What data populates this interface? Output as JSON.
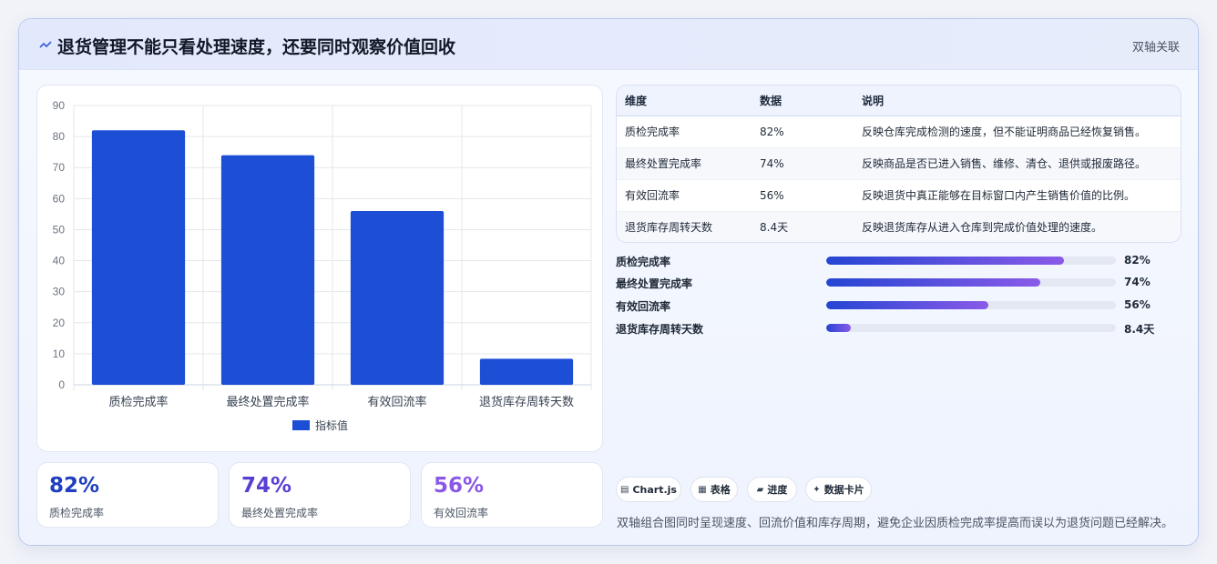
{
  "header": {
    "icon": "trend-line-icon",
    "title": "退货管理不能只看处理速度，还要同时观察价值回收",
    "tag": "双轴关联"
  },
  "chart_data": {
    "type": "bar",
    "categories": [
      "质检完成率",
      "最终处置完成率",
      "有效回流率",
      "退货库存周转天数"
    ],
    "series": [
      {
        "name": "指标值",
        "values": [
          82,
          74,
          56,
          8.4
        ],
        "color": "#1c4fd6"
      }
    ],
    "ylim": [
      0,
      90
    ],
    "yticks": [
      0,
      10,
      20,
      30,
      40,
      50,
      60,
      70,
      80,
      90
    ],
    "grid": true,
    "legend": "bottom"
  },
  "kpis": [
    {
      "value": "82%",
      "label": "质检完成率",
      "color": "#1f3fbf"
    },
    {
      "value": "74%",
      "label": "最终处置完成率",
      "color": "#5a3ed4"
    },
    {
      "value": "56%",
      "label": "有效回流率",
      "color": "#8a57e6"
    }
  ],
  "table": {
    "headers": [
      "维度",
      "数据",
      "说明"
    ],
    "rows": [
      [
        "质检完成率",
        "82%",
        "反映仓库完成检测的速度，但不能证明商品已经恢复销售。"
      ],
      [
        "最终处置完成率",
        "74%",
        "反映商品是否已进入销售、维修、清仓、退供或报废路径。"
      ],
      [
        "有效回流率",
        "56%",
        "反映退货中真正能够在目标窗口内产生销售价值的比例。"
      ],
      [
        "退货库存周转天数",
        "8.4天",
        "反映退货库存从进入仓库到完成价值处理的速度。"
      ]
    ]
  },
  "progress": [
    {
      "label": "质检完成率",
      "display": "82%",
      "fraction": 0.82
    },
    {
      "label": "最终处置完成率",
      "display": "74%",
      "fraction": 0.74
    },
    {
      "label": "有效回流率",
      "display": "56%",
      "fraction": 0.56
    },
    {
      "label": "退货库存周转天数",
      "display": "8.4天",
      "fraction": 0.084
    }
  ],
  "chips": [
    {
      "icon": "chart-icon",
      "glyph": "▤",
      "label": "Chart.js"
    },
    {
      "icon": "table-icon",
      "glyph": "▦",
      "label": "表格"
    },
    {
      "icon": "progress-icon",
      "glyph": "▰",
      "label": "进度"
    },
    {
      "icon": "sparkle-icon",
      "glyph": "✦",
      "label": "数据卡片"
    }
  ],
  "footnote": "双轴组合图同时呈现速度、回流价值和库存周期，避免企业因质检完成率提高而误以为退货问题已经解决。"
}
